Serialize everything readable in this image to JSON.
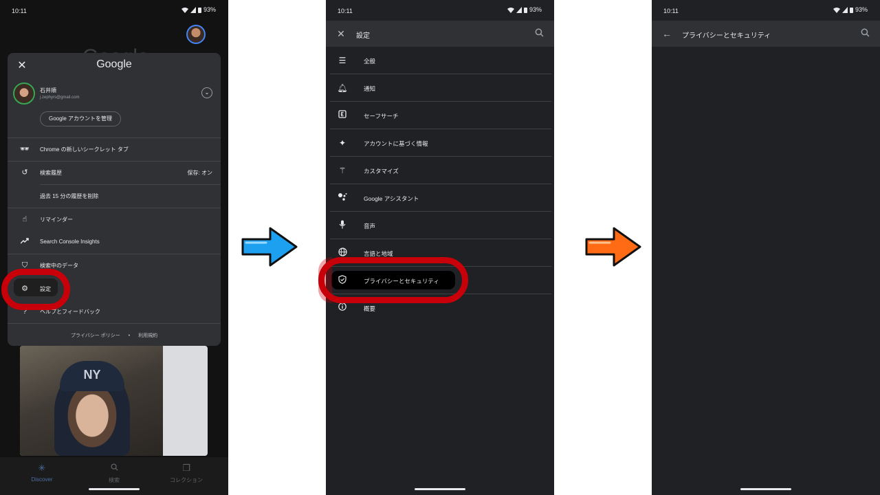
{
  "status_bar": {
    "time": "10:11",
    "battery": "93%"
  },
  "phone1": {
    "background_logo": "Google",
    "sheet": {
      "close_icon": "close-icon",
      "logo": "Google",
      "account_name": "石井順",
      "account_email": "j.zephyrs@gmail.com",
      "manage_button": "Google アカウントを管理",
      "items": [
        {
          "icon": "incognito-icon",
          "label": "Chrome の新しいシークレット タブ",
          "value": ""
        },
        {
          "icon": "history-icon",
          "label": "検索履歴",
          "value": "保存: オン"
        },
        {
          "icon": "",
          "label": "過去 15 分の履歴を削除",
          "value": ""
        },
        {
          "icon": "reminder-icon",
          "label": "リマインダー",
          "value": ""
        },
        {
          "icon": "trending-up-icon",
          "label": "Search Console Insights",
          "value": ""
        },
        {
          "icon": "shield-icon",
          "label": "検索中のデータ",
          "value": ""
        },
        {
          "icon": "gear-icon",
          "label": "設定",
          "value": ""
        },
        {
          "icon": "help-icon",
          "label": "ヘルプとフィードバック",
          "value": ""
        }
      ],
      "footer": {
        "privacy": "プライバシー ポリシー",
        "separator": "•",
        "terms": "利用規約"
      }
    },
    "bottom_nav": [
      {
        "icon": "discover-icon",
        "label": "Discover"
      },
      {
        "icon": "search-icon",
        "label": "検索"
      },
      {
        "icon": "collections-icon",
        "label": "コレクション"
      }
    ]
  },
  "phone2": {
    "title": "設定",
    "items": [
      {
        "icon": "tune-icon",
        "label": "全般"
      },
      {
        "icon": "bell-icon",
        "label": "通知"
      },
      {
        "icon": "explicit-icon",
        "label": "セーフサーチ"
      },
      {
        "icon": "sparkle-icon",
        "label": "アカウントに基づく情報"
      },
      {
        "icon": "magic-wand-icon",
        "label": "カスタマイズ"
      },
      {
        "icon": "assistant-icon",
        "label": "Google アシスタント"
      },
      {
        "icon": "mic-icon",
        "label": "音声"
      },
      {
        "icon": "globe-icon",
        "label": "言語と地域"
      },
      {
        "icon": "shield-check-icon",
        "label": "プライバシーとセキュリティ"
      },
      {
        "icon": "info-icon",
        "label": "概要"
      }
    ]
  },
  "phone3": {
    "title": "プライバシーとセキュリティ"
  },
  "colors": {
    "highlight": "#c8000a",
    "arrow1": "#1ea0f0",
    "arrow2": "#ff6a14"
  }
}
